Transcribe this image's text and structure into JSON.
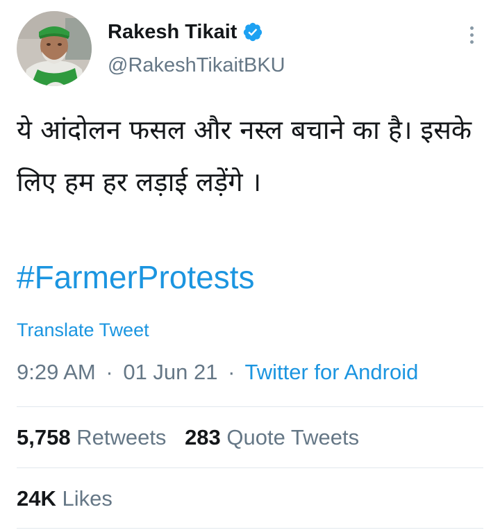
{
  "author": {
    "display_name": "Rakesh Tikait",
    "handle": "@RakeshTikaitBKU",
    "verified": true
  },
  "tweet": {
    "text": "ये आंदोलन फसल और नस्ल बचाने का है। इसके लिए हम हर लड़ाई लड़ेंगे ।",
    "hashtag": "#FarmerProtests",
    "translate_label": "Translate Tweet",
    "time": "9:29 AM",
    "separator": "·",
    "date": "01 Jun 21",
    "source": "Twitter for Android"
  },
  "stats": {
    "retweets_count": "5,758",
    "retweets_label": "Retweets",
    "quotes_count": "283",
    "quotes_label": "Quote Tweets",
    "likes_count": "24K",
    "likes_label": "Likes"
  },
  "colors": {
    "link": "#1b95e0",
    "secondary_text": "#657786",
    "primary_text": "#14171a",
    "divider": "#e1e8ed",
    "verified_badge": "#1da1f2"
  },
  "icons": {
    "verified": "verified-badge-icon",
    "more": "more-options-icon"
  }
}
